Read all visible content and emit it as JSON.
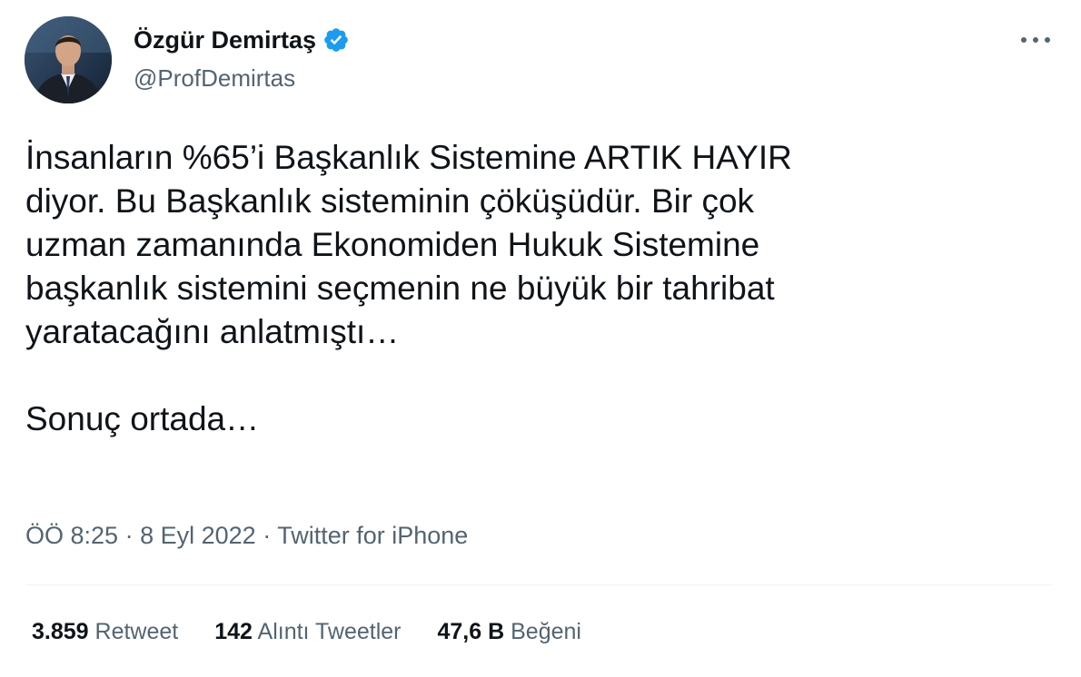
{
  "author": {
    "display_name": "Özgür Demirtaş",
    "handle": "@ProfDemirtas",
    "verified": true,
    "avatar_icon": "profile-photo"
  },
  "tweet": {
    "paragraphs": [
      "İnsanların %65’i Başkanlık Sistemine ARTIK HAYIR\ndiyor. Bu Başkanlık sisteminin çöküşüdür. Bir çok\nuzman zamanında Ekonomiden Hukuk Sistemine\nbaşkanlık sistemini seçmenin ne büyük bir tahribat\nyaratacağını anlatmıştı…",
      "Sonuç ortada…"
    ],
    "time": "ÖÖ 8:25",
    "date": "8 Eyl 2022",
    "source": "Twitter for iPhone",
    "separator": "·"
  },
  "stats": {
    "retweets": {
      "count": "3.859",
      "label": "Retweet"
    },
    "quotes": {
      "count": "142",
      "label": "Alıntı Tweetler"
    },
    "likes": {
      "count": "47,6 B",
      "label": "Beğeni"
    }
  },
  "colors": {
    "text_primary": "#0f1419",
    "text_secondary": "#536471",
    "verified_blue": "#1d9bf0",
    "divider": "#eff3f4"
  },
  "icons": {
    "more": "more-horizontal-icon",
    "verified": "verified-badge-icon"
  }
}
